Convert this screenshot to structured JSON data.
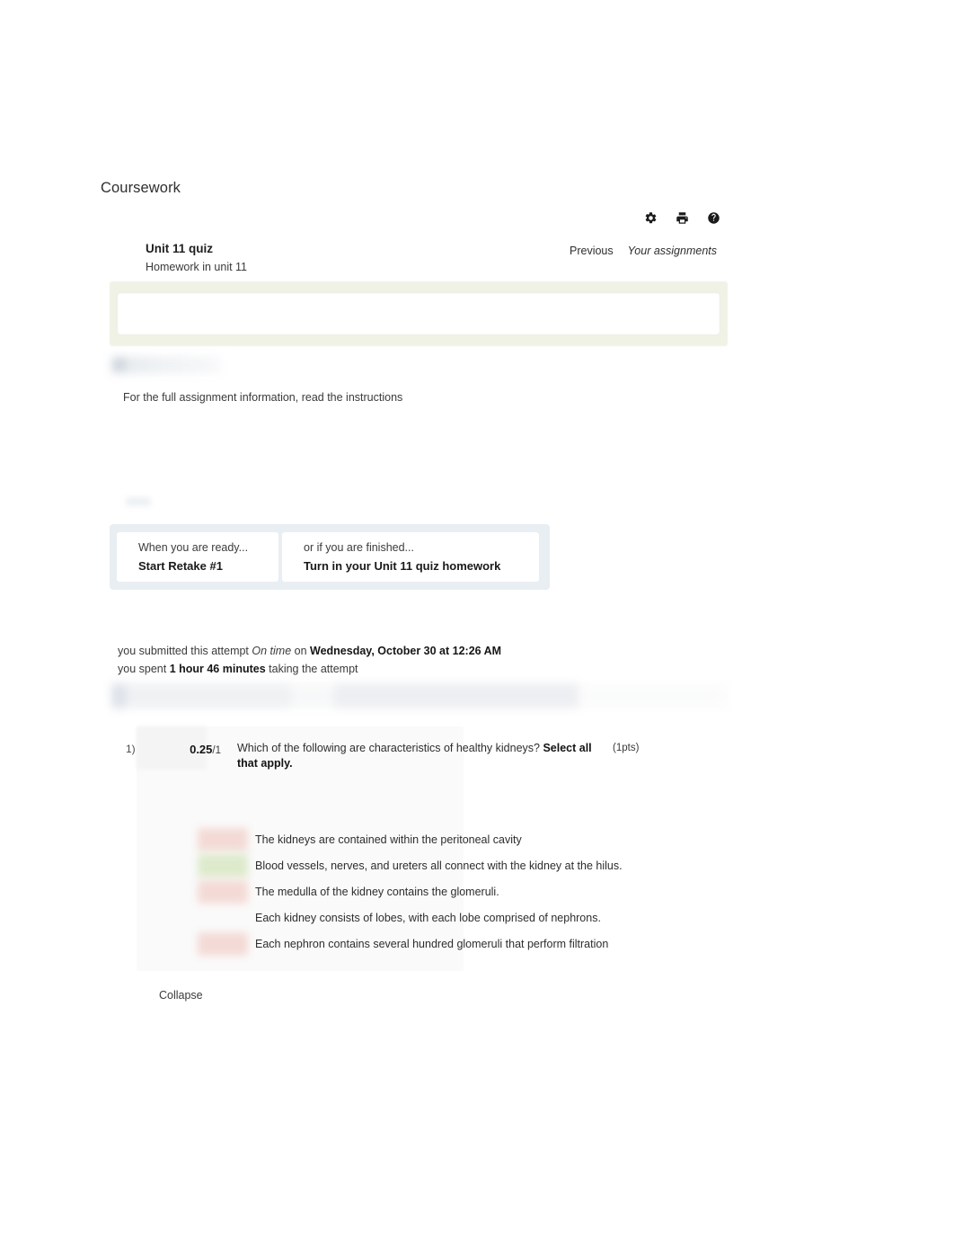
{
  "page": {
    "title": "Coursework"
  },
  "toolbar": {
    "icons": [
      {
        "name": "gear-icon",
        "label": "Settings"
      },
      {
        "name": "printer-icon",
        "label": "Print"
      },
      {
        "name": "help-icon",
        "label": "Help"
      }
    ]
  },
  "assignment": {
    "title": "Unit 11 quiz",
    "subtitle": "Homework in unit 11",
    "nav": {
      "previous": "Previous",
      "your_assignments": "Your assignments"
    }
  },
  "instructions": {
    "prefix": "For the full assignment information, read the ",
    "link": "instructions"
  },
  "actions": {
    "retake": {
      "pre": "When you are ready...",
      "main": "Start Retake #1"
    },
    "turn_in": {
      "pre": "or if you are finished...",
      "main": "Turn in your Unit 11 quiz homework"
    }
  },
  "submission": {
    "line1_a": "you submitted this attempt ",
    "line1_status": "On time",
    "line1_b": " on ",
    "line1_datetime": "Wednesday, October 30 at 12:26 AM",
    "line2_a": "you spent ",
    "line2_duration": "1 hour 46 minutes",
    "line2_b": " taking the attempt"
  },
  "question": {
    "number": "1)",
    "score_earned": "0.25",
    "score_possible": "/1",
    "points": "(1pts)",
    "text_a": "Which of the following are characteristics of healthy kidneys? ",
    "text_bold": "Select all that apply.",
    "options": [
      {
        "badge": "wrong",
        "text": "The kidneys are contained within the peritoneal cavity"
      },
      {
        "badge": "right",
        "text": "Blood vessels, nerves, and ureters all connect with the kidney at the hilus."
      },
      {
        "badge": "wrong",
        "text": "The medulla of the kidney contains the glomeruli."
      },
      {
        "badge": "none",
        "text": "Each kidney consists of lobes, with each lobe comprised of nephrons."
      },
      {
        "badge": "wrong",
        "text": "Each nephron contains several hundred glomeruli that perform filtration"
      }
    ]
  },
  "footer": {
    "collapse": "Collapse"
  },
  "colors": {
    "banner_bg": "#f0f2e6",
    "action_panel_bg": "#e8eef2",
    "badge_wrong": "#f3d9d4",
    "badge_right": "#dce9c9",
    "page_bg": "#ffffff",
    "text": "#2b2b2b"
  }
}
